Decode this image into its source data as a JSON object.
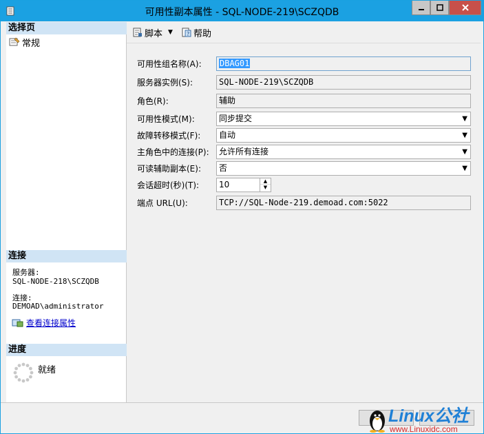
{
  "window": {
    "title": "可用性副本属性 - SQL-NODE-219\\SCZQDB"
  },
  "left_panel": {
    "select_page_header": "选择页",
    "nav_items": [
      {
        "label": "常规"
      }
    ],
    "connection_header": "连接",
    "server_label": "服务器:",
    "server_value": "SQL-NODE-218\\SCZQDB",
    "connection_label": "连接:",
    "connection_value": "DEMOAD\\administrator",
    "view_connection_link": "查看连接属性",
    "progress_header": "进度",
    "progress_status": "就绪"
  },
  "toolbar": {
    "script_label": "脚本",
    "help_label": "帮助"
  },
  "form": {
    "group_name_label": "可用性组名称(A):",
    "group_name_value": "DBAG01",
    "server_instance_label": "服务器实例(S):",
    "server_instance_value": "SQL-NODE-219\\SCZQDB",
    "role_label": "角色(R):",
    "role_value": "辅助",
    "availability_mode_label": "可用性模式(M):",
    "availability_mode_value": "同步提交",
    "failover_mode_label": "故障转移模式(F):",
    "failover_mode_value": "自动",
    "primary_role_conn_label": "主角色中的连接(P):",
    "primary_role_conn_value": "允许所有连接",
    "readable_secondary_label": "可读辅助副本(E):",
    "readable_secondary_value": "否",
    "session_timeout_label": "会话超时(秒)(T):",
    "session_timeout_value": "10",
    "endpoint_url_label": "端点 URL(U):",
    "endpoint_url_value": "TCP://SQL-Node-219.demoad.com:5022"
  },
  "watermark": {
    "brand": "Linux公社",
    "url": "www.Linuxidc.com"
  },
  "colors": {
    "titlebar": "#1ba1e2",
    "section_header": "#d0e4f5",
    "link": "#0000cc",
    "selection": "#3399ff"
  }
}
